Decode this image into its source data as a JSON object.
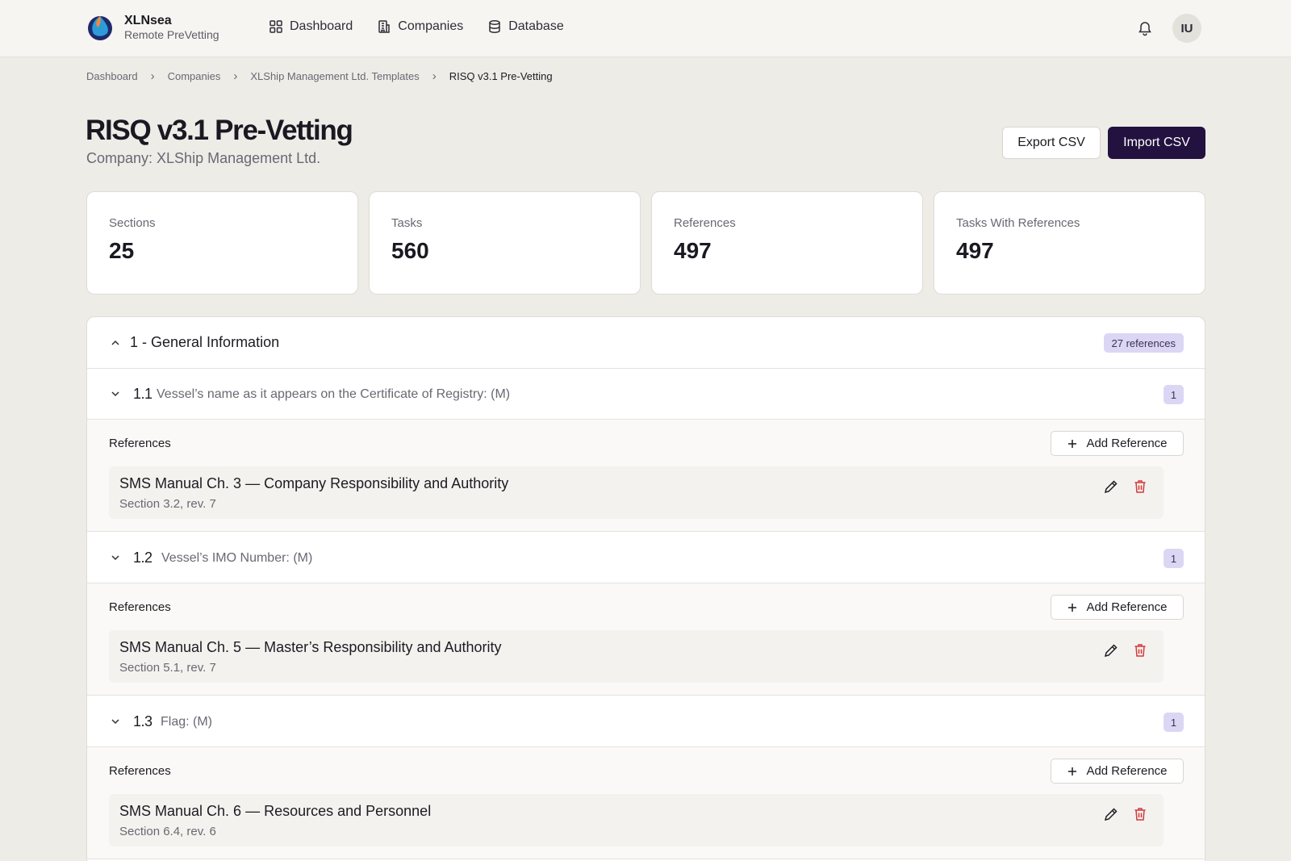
{
  "brand": {
    "name": "XLNsea",
    "subtitle": "Remote PreVetting"
  },
  "nav": [
    {
      "label": "Dashboard",
      "icon": "grid-icon"
    },
    {
      "label": "Companies",
      "icon": "building-icon"
    },
    {
      "label": "Database",
      "icon": "database-icon"
    }
  ],
  "user": {
    "initials": "IU"
  },
  "breadcrumb": [
    "Dashboard",
    "Companies",
    "XLShip Management Ltd. Templates",
    "RISQ v3.1 Pre-Vetting"
  ],
  "page": {
    "title": "RISQ v3.1 Pre-Vetting",
    "subtitle": "Company: XLShip Management Ltd.",
    "export_label": "Export CSV",
    "import_label": "Import CSV"
  },
  "stats": [
    {
      "label": "Sections",
      "value": "25"
    },
    {
      "label": "Tasks",
      "value": "560"
    },
    {
      "label": "References",
      "value": "497"
    },
    {
      "label": "Tasks With References",
      "value": "497"
    }
  ],
  "section": {
    "title": "1 - General Information",
    "references_badge": "27 references",
    "tasks": [
      {
        "number": "1.1",
        "description": "Vessel’s name as it appears on the Certificate of Registry: (M)",
        "count": "1",
        "references_label": "References",
        "add_label": "Add Reference",
        "reference": {
          "title": "SMS Manual Ch. 3 — Company Responsibility and Authority",
          "detail": "Section 3.2, rev. 7"
        }
      },
      {
        "number": "1.2",
        "description": "Vessel’s IMO Number: (M)",
        "count": "1",
        "references_label": "References",
        "add_label": "Add Reference",
        "reference": {
          "title": "SMS Manual Ch. 5 — Master’s Responsibility and Authority",
          "detail": "Section 5.1, rev. 7"
        }
      },
      {
        "number": "1.3",
        "description": "Flag: (M)",
        "count": "1",
        "references_label": "References",
        "add_label": "Add Reference",
        "reference": {
          "title": "SMS Manual Ch. 6 — Resources and Personnel",
          "detail": "Section 6.4, rev. 6"
        }
      }
    ]
  },
  "colors": {
    "accent": "#23123f",
    "badge": "#dcd6f5",
    "delete": "#d23a3a",
    "background": "#edece7"
  }
}
